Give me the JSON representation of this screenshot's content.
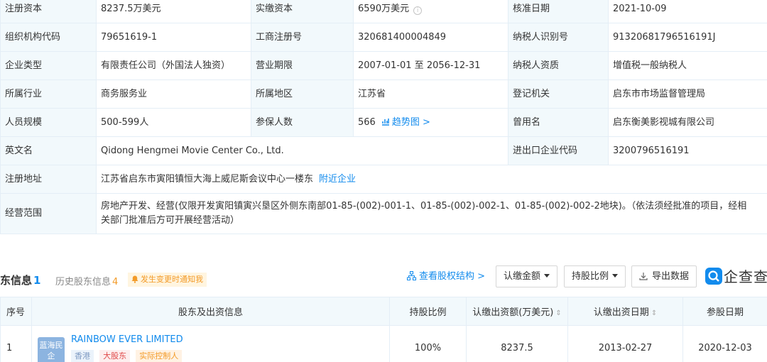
{
  "basic_info": {
    "rows": [
      {
        "cells": [
          {
            "key": "注册资本",
            "value": "8237.5万美元"
          },
          {
            "key": "实缴资本",
            "value": "6590万美元"
          },
          {
            "key": "核准日期",
            "value": "2021-10-09"
          }
        ]
      },
      {
        "cells": [
          {
            "key": "组织机构代码",
            "value": "79651619-1"
          },
          {
            "key": "工商注册号",
            "value": "320681400004849"
          },
          {
            "key": "纳税人识别号",
            "value": "91320681796516191J"
          }
        ]
      },
      {
        "cells": [
          {
            "key": "企业类型",
            "value": "有限责任公司（外国法人独资）"
          },
          {
            "key": "营业期限",
            "value": "2007-01-01 至 2056-12-31"
          },
          {
            "key": "纳税人资质",
            "value": "增值税一般纳税人"
          }
        ]
      },
      {
        "cells": [
          {
            "key": "所属行业",
            "value": "商务服务业"
          },
          {
            "key": "所属地区",
            "value": "江苏省"
          },
          {
            "key": "登记机关",
            "value": "启东市市场监督管理局"
          }
        ]
      },
      {
        "cells": [
          {
            "key": "人员规模",
            "value": "500-599人"
          },
          {
            "key": "参保人数",
            "value": "566",
            "link": "趋势图 >"
          },
          {
            "key": "曾用名",
            "value": "启东衡美影视城有限公司"
          }
        ]
      }
    ],
    "english_name": {
      "key": "英文名",
      "value": "Qidong Hengmei Movie Center Co., Ltd."
    },
    "import_export_code": {
      "key": "进出口企业代码",
      "value": "3200796516191"
    },
    "address": {
      "key": "注册地址",
      "value": "江苏省启东市寅阳镇恒大海上威尼斯会议中心一楼东",
      "link": "附近企业"
    },
    "business_scope": {
      "key": "经营范围",
      "value": "房地产开发、经营(仅限开发寅阳镇寅兴垦区外侧东南部01-85-(002)-001-1、01-85-(002)-002-1、01-85-(002)-002-2地块)。（依法须经批准的项目，经相关部门批准后方可开展经营活动）"
    }
  },
  "shareholders": {
    "title": "股东信息",
    "count": "1",
    "history_label": "历史股东信息",
    "history_count": "4",
    "notify_label": "发生变更时通知我",
    "equity_link": "查看股权结构 >",
    "subscribed_amount_filter": "认缴金额",
    "share_ratio_filter": "持股比例",
    "export_label": "导出数据",
    "logo_text": "企查查",
    "columns": [
      "序号",
      "股东及出资信息",
      "持股比例",
      "认缴出资额(万美元)",
      "认缴出资日期",
      "参股日期"
    ],
    "rows": [
      {
        "index": "1",
        "logo_text": "蓝海民企",
        "name": "RAINBOW EVER LIMITED",
        "tags": [
          "香港",
          "大股东",
          "实际控制人"
        ],
        "ratio": "100%",
        "amount": "8237.5",
        "subscribe_date": "2013-02-27",
        "join_date": "2020-12-03"
      }
    ]
  },
  "colors": {
    "accent": "#128bed",
    "key_cell_bg": "#f2f9fc",
    "border": "#e4eef6",
    "orange": "#f39b28",
    "red": "#e04a4a"
  }
}
